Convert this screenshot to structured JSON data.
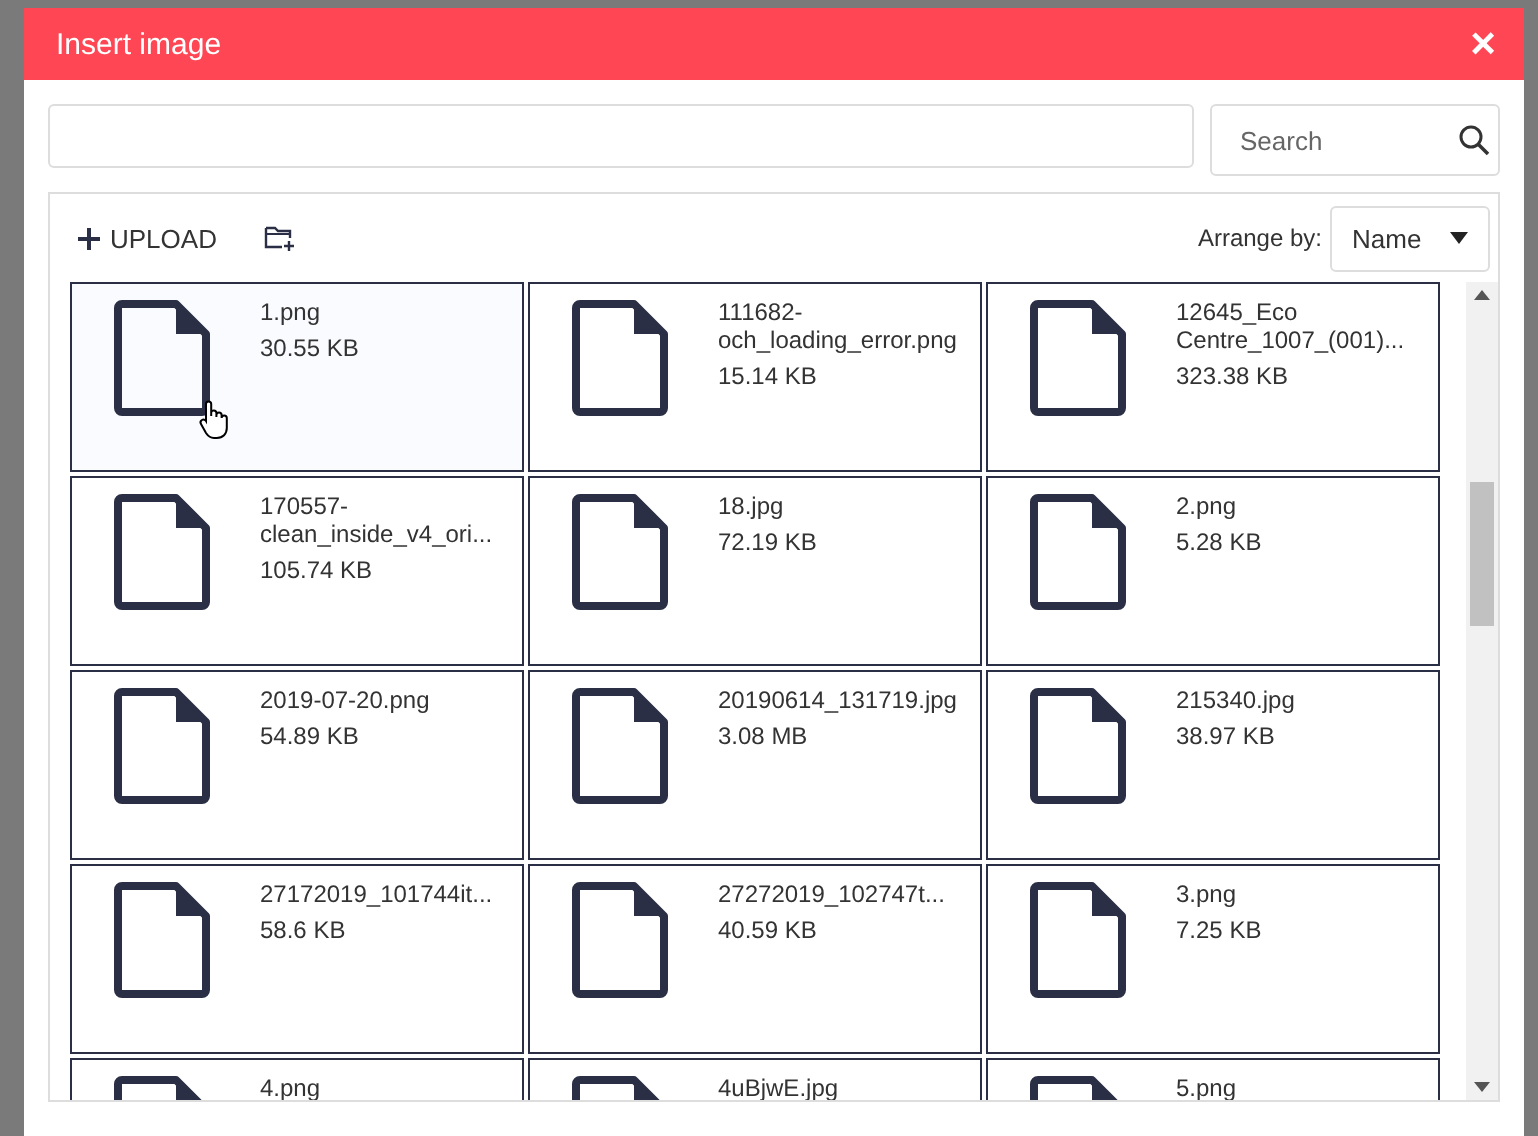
{
  "dialog": {
    "title": "Insert image",
    "close": "×"
  },
  "search": {
    "placeholder": "Search"
  },
  "toolbar": {
    "upload": "UPLOAD",
    "arrange_label": "Arrange by:",
    "arrange_value": "Name"
  },
  "files": [
    {
      "name": "1.png",
      "size": "30.55 KB",
      "hovered": true
    },
    {
      "name": "111682-och_loading_error.png",
      "size": "15.14 KB",
      "hovered": false
    },
    {
      "name": "12645_Eco Centre_1007_(001)...",
      "size": "323.38 KB",
      "hovered": false
    },
    {
      "name": "170557-clean_inside_v4_ori...",
      "size": "105.74 KB",
      "hovered": false
    },
    {
      "name": "18.jpg",
      "size": "72.19 KB",
      "hovered": false
    },
    {
      "name": "2.png",
      "size": "5.28 KB",
      "hovered": false
    },
    {
      "name": "2019-07-20.png",
      "size": "54.89 KB",
      "hovered": false
    },
    {
      "name": "20190614_131719.jpg",
      "size": "3.08 MB",
      "hovered": false
    },
    {
      "name": "215340.jpg",
      "size": "38.97 KB",
      "hovered": false
    },
    {
      "name": "27172019_101744it...",
      "size": "58.6 KB",
      "hovered": false
    },
    {
      "name": "27272019_102747t...",
      "size": "40.59 KB",
      "hovered": false
    },
    {
      "name": "3.png",
      "size": "7.25 KB",
      "hovered": false
    },
    {
      "name": "4.png"
    },
    {
      "name": "4uBjwE.jpg"
    },
    {
      "name": "5.png"
    }
  ]
}
